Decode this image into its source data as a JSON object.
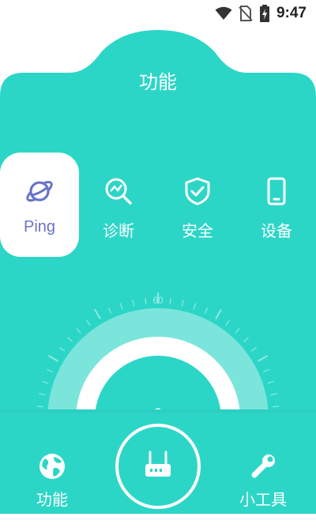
{
  "status_bar": {
    "time": "9:47",
    "icons": [
      "wifi-icon",
      "no-sim-icon",
      "battery-charging-icon"
    ]
  },
  "page": {
    "title": "功能"
  },
  "tabs": [
    {
      "label": "Ping",
      "icon": "planet-icon",
      "active": true
    },
    {
      "label": "诊断",
      "icon": "diagnose-search-icon",
      "active": false
    },
    {
      "label": "安全",
      "icon": "shield-check-icon",
      "active": false
    },
    {
      "label": "设备",
      "icon": "phone-device-icon",
      "active": false
    }
  ],
  "gauge": {
    "scale_label": "60",
    "value": "0"
  },
  "bottom_nav": {
    "left": {
      "label": "功能",
      "icon": "globe-icon",
      "active": true
    },
    "center": {
      "icon": "router-icon"
    },
    "right": {
      "label": "小工具",
      "icon": "wrench-icon",
      "active": false
    }
  },
  "colors": {
    "accent": "#2cd6c7",
    "active_tab_text": "#6a73c6",
    "background": "#ffffff"
  }
}
